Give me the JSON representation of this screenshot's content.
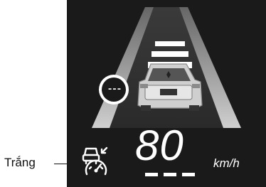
{
  "callout": {
    "label": "Trắng"
  },
  "display": {
    "speed": "80",
    "unit": "km/h",
    "lane_indicator": "---",
    "colors": {
      "background": "#1a1a1a",
      "text": "#ffffff",
      "callout": "#111111"
    },
    "icons": {
      "cruise_control": "car-speedometer-icon",
      "lane_indicator": "lane-departure-indicator-icon",
      "vehicle": "rear-vehicle-icon"
    }
  }
}
